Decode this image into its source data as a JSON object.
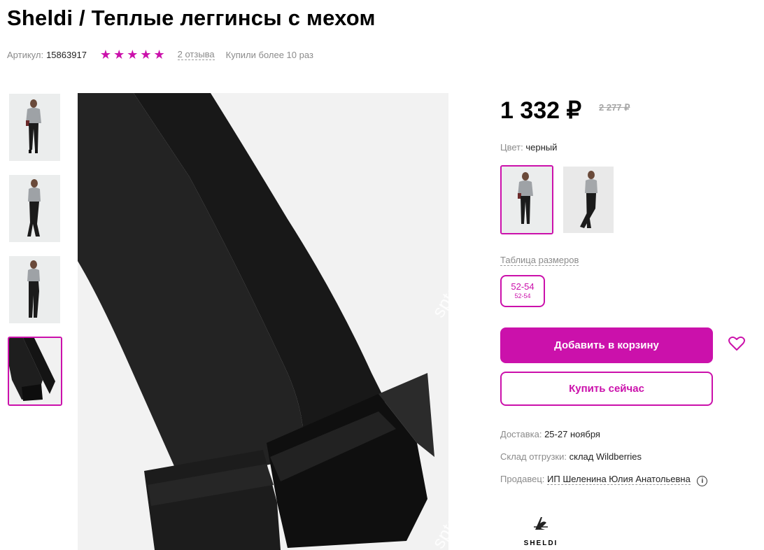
{
  "product": {
    "title": "Sheldi / Теплые леггинсы с мехом",
    "sku_label": "Артикул:",
    "sku": "15863917",
    "rating_stars": 5,
    "reviews": "2 отзыва",
    "bought": "Купили более 10 раз"
  },
  "gallery": {
    "thumbnails": [
      {
        "alt": "model-front"
      },
      {
        "alt": "model-side"
      },
      {
        "alt": "model-back"
      },
      {
        "alt": "leggings-fur-detail",
        "active": true
      }
    ],
    "watermark": "sptc"
  },
  "price": {
    "current": "1 332 ₽",
    "old": "2 277 ₽"
  },
  "color": {
    "label": "Цвет:",
    "value": "черный"
  },
  "sizes": {
    "table_link": "Таблица размеров",
    "options": [
      {
        "label": "52-54",
        "sub": "52-54",
        "selected": true
      }
    ]
  },
  "actions": {
    "add_to_cart": "Добавить в корзину",
    "buy_now": "Купить сейчас"
  },
  "delivery": {
    "delivery_label": "Доставка:",
    "delivery_value": "25-27 ноября",
    "warehouse_label": "Склад отгрузки:",
    "warehouse_value": "склад Wildberries",
    "seller_label": "Продавец:",
    "seller_value": "ИП Шеленина Юлия Анатольевна"
  },
  "brand": {
    "name": "SHELDI"
  },
  "colors": {
    "accent": "#cb11ab",
    "muted_text": "#8b8b8b"
  }
}
